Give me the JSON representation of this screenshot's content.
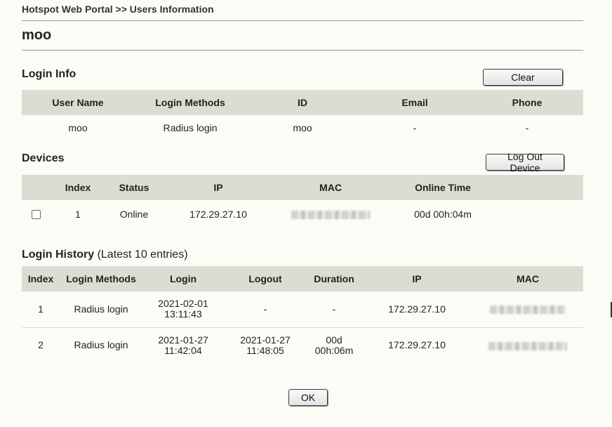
{
  "breadcrumb": "Hotspot Web Portal >> Users Information",
  "page_title": "moo",
  "login_info": {
    "title": "Login Info",
    "clear_label": "Clear",
    "columns": [
      "User Name",
      "Login Methods",
      "ID",
      "Email",
      "Phone"
    ],
    "rows": [
      [
        "moo",
        "Radius login",
        "moo",
        "-",
        "-"
      ]
    ]
  },
  "devices": {
    "title": "Devices",
    "logout_label": "Log Out Device",
    "columns": [
      "",
      "Index",
      "Status",
      "IP",
      "MAC",
      "Online Time"
    ],
    "rows": [
      {
        "index": "1",
        "status": "Online",
        "ip": "172.29.27.10",
        "mac": "",
        "online_time": "00d 00h:04m"
      }
    ]
  },
  "history": {
    "title": "Login History",
    "subtitle": "(Latest 10 entries)",
    "columns": [
      "Index",
      "Login Methods",
      "Login",
      "Logout",
      "Duration",
      "IP",
      "MAC"
    ],
    "rows": [
      {
        "index": "1",
        "method": "Radius login",
        "login_date": "2021-02-01",
        "login_time": "13:11:43",
        "logout_date": "-",
        "logout_time": "",
        "duration_1": "-",
        "duration_2": "",
        "ip": "172.29.27.10",
        "mac": ""
      },
      {
        "index": "2",
        "method": "Radius login",
        "login_date": "2021-01-27",
        "login_time": "11:42:04",
        "logout_date": "2021-01-27",
        "logout_time": "11:48:05",
        "duration_1": "00d",
        "duration_2": "00h:06m",
        "ip": "172.29.27.10",
        "mac": ""
      }
    ]
  },
  "ok_label": "OK",
  "colors": {
    "background": "#fcfcf6",
    "header_row": "#dcdcd2",
    "rule": "#9a9a94"
  }
}
